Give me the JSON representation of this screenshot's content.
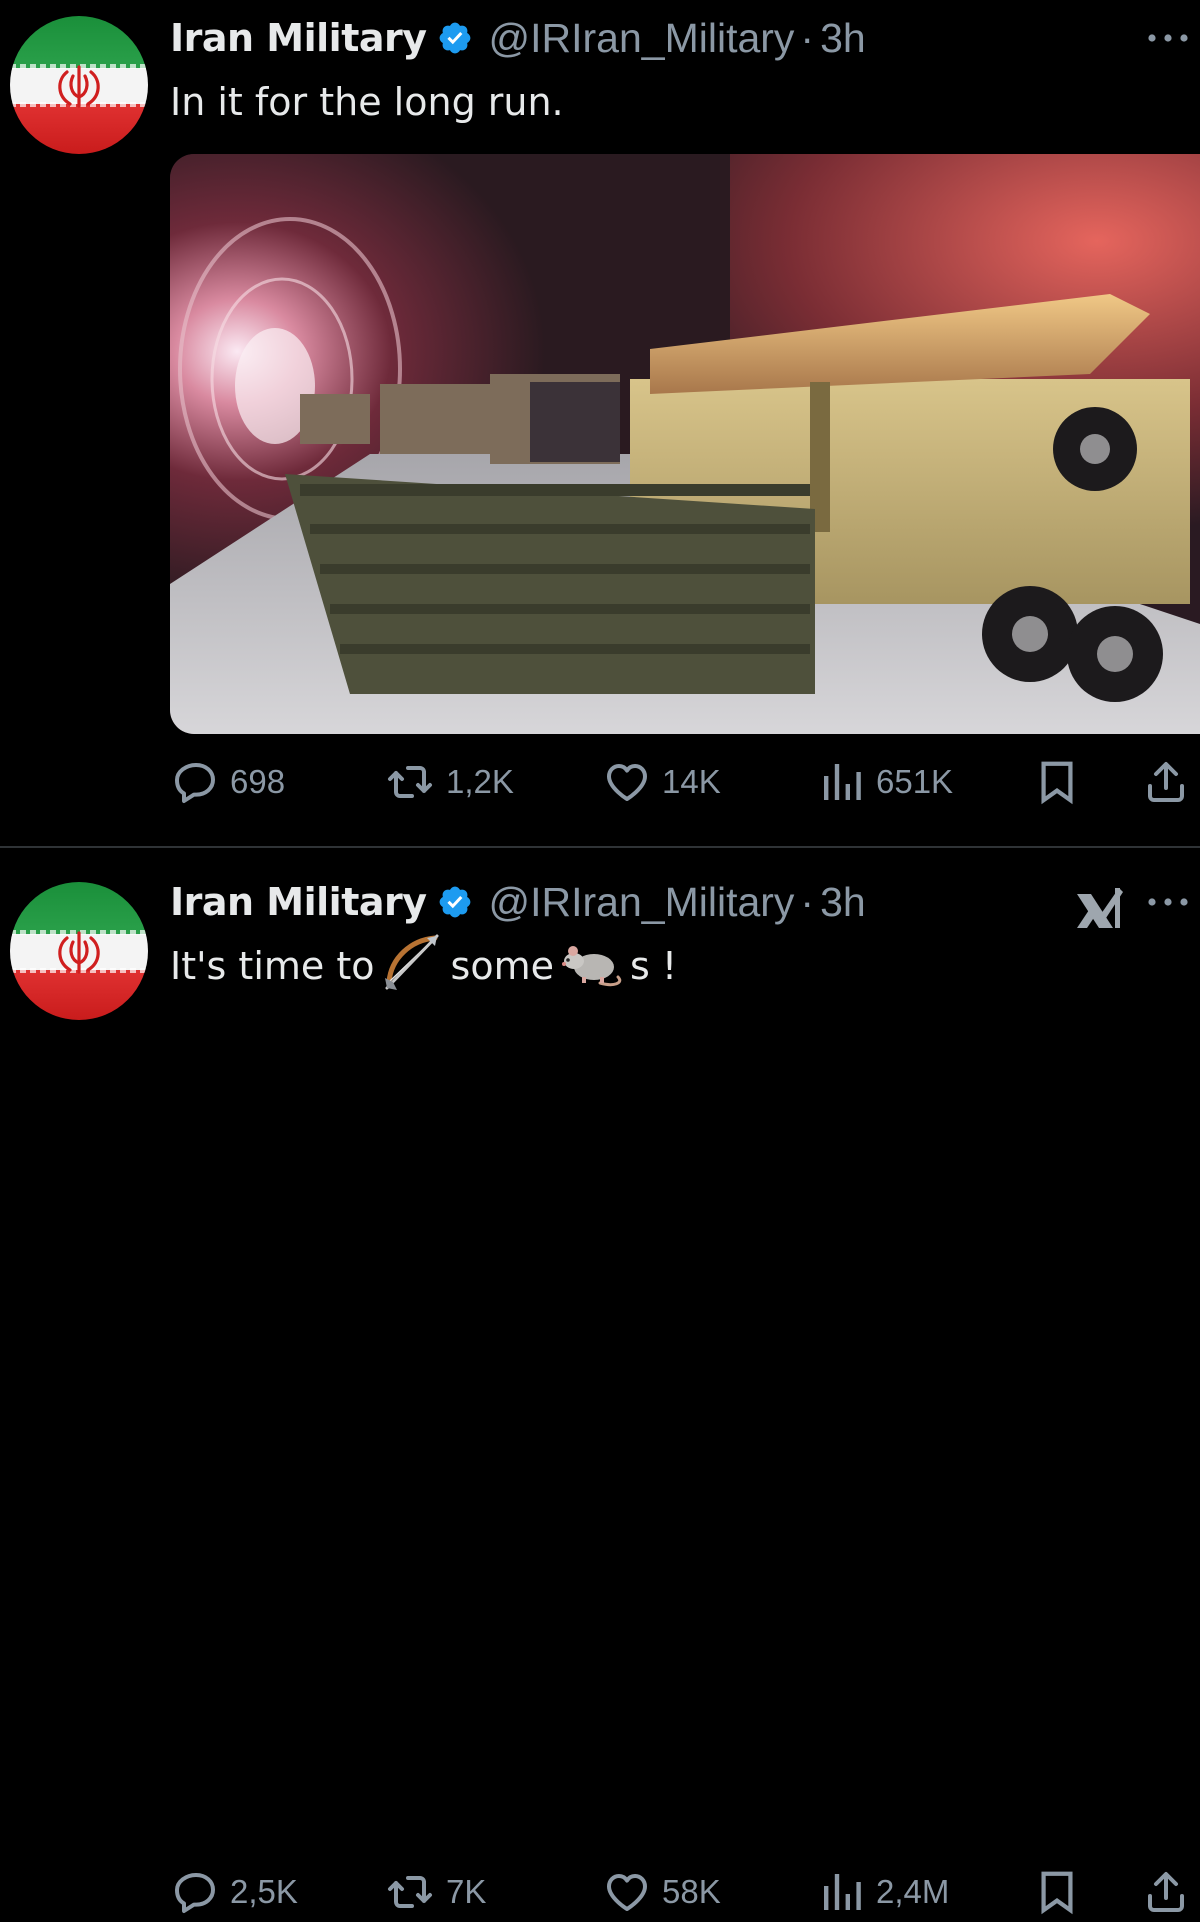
{
  "tweets": [
    {
      "author_name": "Iran Military",
      "handle": "@IRIran_Military",
      "separator": "·",
      "time": "3h",
      "text": "In it for the long run.",
      "has_media": true,
      "stats": {
        "replies": "698",
        "reposts": "1,2K",
        "likes": "14K",
        "views": "651K"
      }
    },
    {
      "author_name": "Iran Military",
      "handle": "@IRIran_Military",
      "separator": "·",
      "time": "3h",
      "text_parts": [
        "It's time to",
        "some",
        "s !"
      ],
      "emojis": [
        "bow-and-arrow",
        "rat"
      ],
      "stats": {
        "replies": "2,5K",
        "reposts": "7K",
        "likes": "58K",
        "views": "2,4M"
      }
    }
  ],
  "icons": {
    "verified": "verified-badge-icon",
    "more": "more-icon",
    "reply": "reply-icon",
    "repost": "repost-icon",
    "like": "like-icon",
    "views": "views-icon",
    "bookmark": "bookmark-icon",
    "share": "share-icon",
    "grok": "grok-icon"
  },
  "colors": {
    "background": "#000000",
    "text": "#e7e9ea",
    "secondary": "#8b98a5",
    "verified": "#1d9bf0",
    "divider": "#2f3336"
  }
}
